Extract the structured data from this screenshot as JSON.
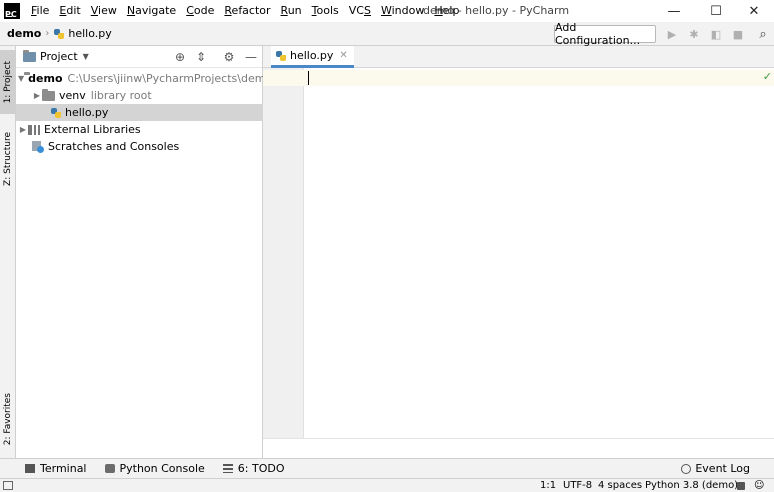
{
  "window": {
    "title": "demo - hello.py - PyCharm",
    "logo_text": "PC",
    "minimize": "—",
    "maximize": "☐",
    "close": "✕"
  },
  "menu": [
    {
      "first": "F",
      "rest": "ile"
    },
    {
      "first": "E",
      "rest": "dit"
    },
    {
      "first": "V",
      "rest": "iew"
    },
    {
      "first": "N",
      "rest": "avigate"
    },
    {
      "first": "C",
      "rest": "ode"
    },
    {
      "first": "R",
      "rest": "efactor"
    },
    {
      "first": "R",
      "rest": "un"
    },
    {
      "first": "T",
      "rest": "ools"
    },
    {
      "first": "VC",
      "rest": "S"
    },
    {
      "first": "W",
      "rest": "indow"
    },
    {
      "first": "H",
      "rest": "elp"
    }
  ],
  "navbar": {
    "breadcrumb_root": "demo",
    "breadcrumb_file": "hello.py",
    "add_configuration": "Add Configuration..."
  },
  "left_strip": {
    "project_tab": "1: Project",
    "structure_tab": "Z: Structure",
    "favorites_tab": "2: Favorites"
  },
  "project": {
    "header_label": "Project",
    "tree": {
      "root_name": "demo",
      "root_path": "C:\\Users\\jiinw\\PycharmProjects\\demo",
      "venv_name": "venv",
      "venv_note": "library root",
      "file_name": "hello.py",
      "external_libraries": "External Libraries",
      "scratches": "Scratches and Consoles"
    }
  },
  "editor": {
    "tab_label": "hello.py"
  },
  "bottom_tools": {
    "terminal": "Terminal",
    "python_console": "Python Console",
    "todo": "6: TODO",
    "event_log": "Event Log"
  },
  "status": {
    "position": "1:1",
    "encoding": "UTF-8",
    "indent": "4 spaces",
    "interpreter": "Python 3.8 (demo)"
  },
  "colors": {
    "tab_accent": "#4a88c7",
    "selection": "#d4d4d4",
    "current_line": "#fcfaed",
    "ok_check": "#3c9a3c"
  }
}
